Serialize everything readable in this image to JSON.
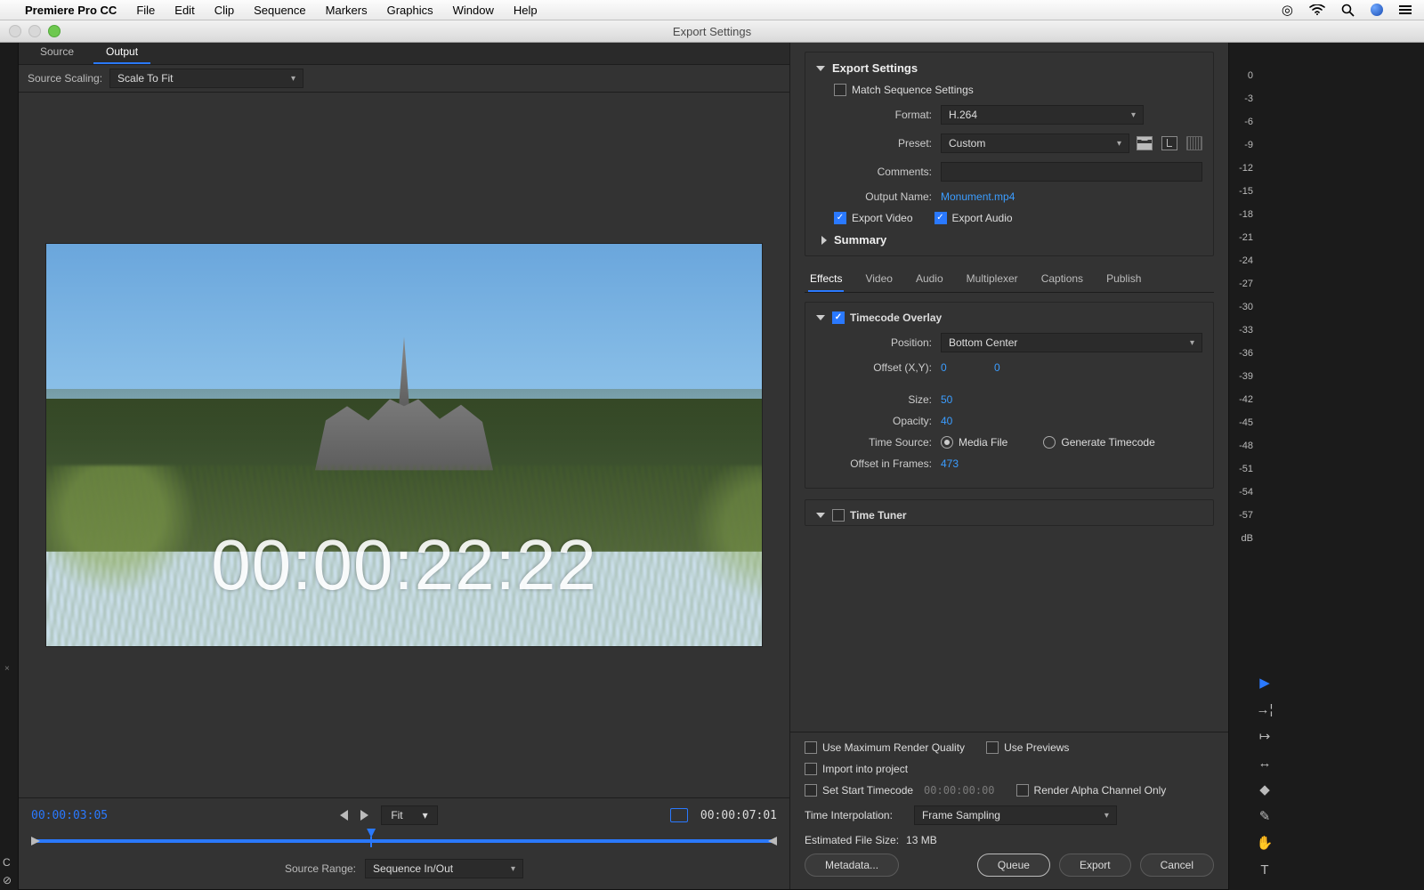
{
  "menubar": {
    "app_name": "Premiere Pro CC",
    "items": [
      "File",
      "Edit",
      "Clip",
      "Sequence",
      "Markers",
      "Graphics",
      "Window",
      "Help"
    ]
  },
  "window": {
    "title": "Export Settings"
  },
  "left": {
    "tabs": {
      "source": "Source",
      "output": "Output"
    },
    "scaling_label": "Source Scaling:",
    "scaling_value": "Scale To Fit",
    "timecode_overlay_text": "00:00:22:22",
    "controls": {
      "current_tc": "00:00:03:05",
      "total_tc": "00:00:07:01",
      "fit_label": "Fit",
      "range_label": "Source Range:",
      "range_value": "Sequence In/Out"
    }
  },
  "export": {
    "section_title": "Export Settings",
    "match_seq": "Match Sequence Settings",
    "format_label": "Format:",
    "format_value": "H.264",
    "preset_label": "Preset:",
    "preset_value": "Custom",
    "comments_label": "Comments:",
    "outputname_label": "Output Name:",
    "outputname_value": "Monument.mp4",
    "export_video": "Export Video",
    "export_audio": "Export Audio",
    "summary": "Summary"
  },
  "subtabs": {
    "effects": "Effects",
    "video": "Video",
    "audio": "Audio",
    "multiplexer": "Multiplexer",
    "captions": "Captions",
    "publish": "Publish"
  },
  "tcoverlay": {
    "title": "Timecode Overlay",
    "position_label": "Position:",
    "position_value": "Bottom Center",
    "offset_label": "Offset (X,Y):",
    "offset_x": "0",
    "offset_y": "0",
    "size_label": "Size:",
    "size_value": "50",
    "opacity_label": "Opacity:",
    "opacity_value": "40",
    "timesource_label": "Time Source:",
    "ts_media": "Media File",
    "ts_gen": "Generate Timecode",
    "offsetframes_label": "Offset in Frames:",
    "offsetframes_value": "473"
  },
  "timetuner": {
    "title": "Time Tuner"
  },
  "bottom": {
    "max_render": "Use Maximum Render Quality",
    "use_previews": "Use Previews",
    "import_proj": "Import into project",
    "set_start_tc": "Set Start Timecode",
    "set_start_tc_val": "00:00:00:00",
    "render_alpha": "Render Alpha Channel Only",
    "time_interp_label": "Time Interpolation:",
    "time_interp_value": "Frame Sampling",
    "est_label": "Estimated File Size:",
    "est_value": "13 MB",
    "btn_metadata": "Metadata...",
    "btn_queue": "Queue",
    "btn_export": "Export",
    "btn_cancel": "Cancel"
  },
  "db_scale": [
    "0",
    "-3",
    "-6",
    "-9",
    "-12",
    "-15",
    "-18",
    "-21",
    "-24",
    "-27",
    "-30",
    "-33",
    "-36",
    "-39",
    "-42",
    "-45",
    "-48",
    "-51",
    "-54",
    "-57",
    "dB"
  ]
}
